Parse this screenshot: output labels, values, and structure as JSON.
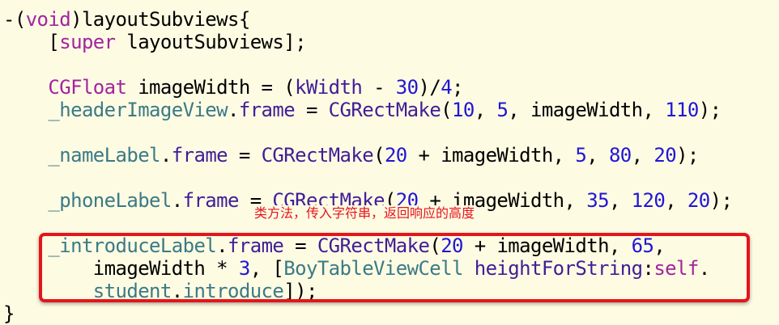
{
  "colors": {
    "background": "#fefbe3",
    "plain": "#000000",
    "keyword": "#a2249f",
    "type_or_method": "#3f1e96",
    "ivar": "#3b7a86",
    "number": "#2016d6",
    "annotation": "#e4151b"
  },
  "annotation": {
    "text": "类方法，传入字符串，返回响应的高度"
  },
  "code_lines": [
    [
      {
        "t": "-(",
        "c": "plain"
      },
      {
        "t": "void",
        "c": "keyword"
      },
      {
        "t": ")layoutSubviews{",
        "c": "plain"
      }
    ],
    [
      {
        "t": "    [",
        "c": "plain"
      },
      {
        "t": "super",
        "c": "keyword"
      },
      {
        "t": " layoutSubviews];",
        "c": "plain"
      }
    ],
    [],
    [
      {
        "t": "    ",
        "c": "plain"
      },
      {
        "t": "CGFloat",
        "c": "keyword"
      },
      {
        "t": " imageWidth = (",
        "c": "plain"
      },
      {
        "t": "kWidth",
        "c": "type_or_method"
      },
      {
        "t": " - ",
        "c": "plain"
      },
      {
        "t": "30",
        "c": "number"
      },
      {
        "t": ")/",
        "c": "plain"
      },
      {
        "t": "4",
        "c": "number"
      },
      {
        "t": ";",
        "c": "plain"
      }
    ],
    [
      {
        "t": "    ",
        "c": "plain"
      },
      {
        "t": "_headerImageView",
        "c": "ivar"
      },
      {
        "t": ".",
        "c": "plain"
      },
      {
        "t": "frame",
        "c": "type_or_method"
      },
      {
        "t": " = ",
        "c": "plain"
      },
      {
        "t": "CGRectMake",
        "c": "type_or_method"
      },
      {
        "t": "(",
        "c": "plain"
      },
      {
        "t": "10",
        "c": "number"
      },
      {
        "t": ", ",
        "c": "plain"
      },
      {
        "t": "5",
        "c": "number"
      },
      {
        "t": ", imageWidth, ",
        "c": "plain"
      },
      {
        "t": "110",
        "c": "number"
      },
      {
        "t": ");",
        "c": "plain"
      }
    ],
    [],
    [
      {
        "t": "    ",
        "c": "plain"
      },
      {
        "t": "_nameLabel",
        "c": "ivar"
      },
      {
        "t": ".",
        "c": "plain"
      },
      {
        "t": "frame",
        "c": "type_or_method"
      },
      {
        "t": " = ",
        "c": "plain"
      },
      {
        "t": "CGRectMake",
        "c": "type_or_method"
      },
      {
        "t": "(",
        "c": "plain"
      },
      {
        "t": "20",
        "c": "number"
      },
      {
        "t": " + imageWidth, ",
        "c": "plain"
      },
      {
        "t": "5",
        "c": "number"
      },
      {
        "t": ", ",
        "c": "plain"
      },
      {
        "t": "80",
        "c": "number"
      },
      {
        "t": ", ",
        "c": "plain"
      },
      {
        "t": "20",
        "c": "number"
      },
      {
        "t": ");",
        "c": "plain"
      }
    ],
    [],
    [
      {
        "t": "    ",
        "c": "plain"
      },
      {
        "t": "_phoneLabel",
        "c": "ivar"
      },
      {
        "t": ".",
        "c": "plain"
      },
      {
        "t": "frame",
        "c": "type_or_method"
      },
      {
        "t": " = ",
        "c": "plain"
      },
      {
        "t": "CGRectMake",
        "c": "type_or_method"
      },
      {
        "t": "(",
        "c": "plain"
      },
      {
        "t": "20",
        "c": "number"
      },
      {
        "t": " + imageWidth, ",
        "c": "plain"
      },
      {
        "t": "35",
        "c": "number"
      },
      {
        "t": ", ",
        "c": "plain"
      },
      {
        "t": "120",
        "c": "number"
      },
      {
        "t": ", ",
        "c": "plain"
      },
      {
        "t": "20",
        "c": "number"
      },
      {
        "t": ");",
        "c": "plain"
      }
    ],
    [],
    [
      {
        "t": "    ",
        "c": "plain"
      },
      {
        "t": "_introduceLabel",
        "c": "ivar"
      },
      {
        "t": ".",
        "c": "plain"
      },
      {
        "t": "frame",
        "c": "type_or_method"
      },
      {
        "t": " = ",
        "c": "plain"
      },
      {
        "t": "CGRectMake",
        "c": "type_or_method"
      },
      {
        "t": "(",
        "c": "plain"
      },
      {
        "t": "20",
        "c": "number"
      },
      {
        "t": " + imageWidth, ",
        "c": "plain"
      },
      {
        "t": "65",
        "c": "number"
      },
      {
        "t": ",",
        "c": "plain"
      }
    ],
    [
      {
        "t": "        imageWidth * ",
        "c": "plain"
      },
      {
        "t": "3",
        "c": "number"
      },
      {
        "t": ", [",
        "c": "plain"
      },
      {
        "t": "BoyTableViewCell",
        "c": "ivar"
      },
      {
        "t": " ",
        "c": "plain"
      },
      {
        "t": "heightForString",
        "c": "type_or_method"
      },
      {
        "t": ":",
        "c": "plain"
      },
      {
        "t": "self",
        "c": "keyword"
      },
      {
        "t": ".",
        "c": "plain"
      }
    ],
    [
      {
        "t": "        ",
        "c": "plain"
      },
      {
        "t": "student",
        "c": "ivar"
      },
      {
        "t": ".",
        "c": "plain"
      },
      {
        "t": "introduce",
        "c": "ivar"
      },
      {
        "t": "]);",
        "c": "plain"
      }
    ],
    [
      {
        "t": "}",
        "c": "plain"
      }
    ]
  ]
}
